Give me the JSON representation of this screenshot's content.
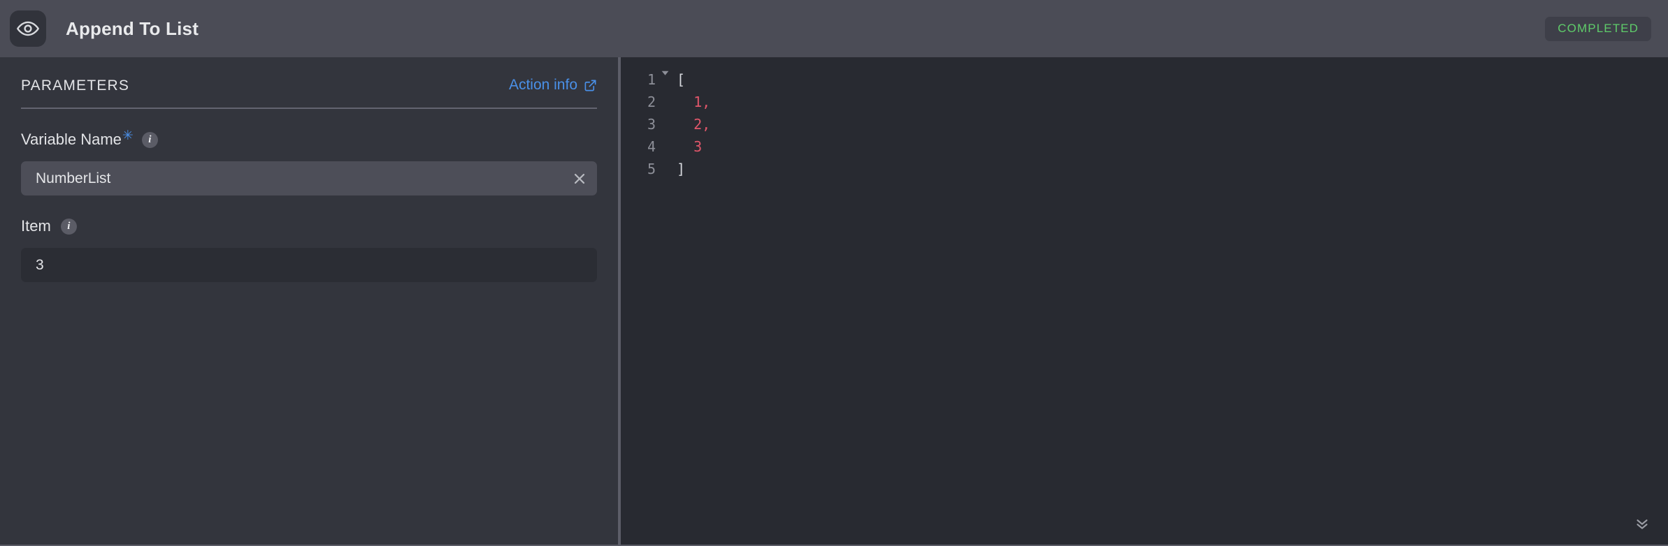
{
  "header": {
    "icon": "eye-icon",
    "title": "Append To List",
    "status": "COMPLETED",
    "status_color": "#5fcc6a",
    "background": "#4b4c56"
  },
  "left_panel": {
    "section_title": "PARAMETERS",
    "action_info": {
      "label": "Action info",
      "icon": "external-link-icon",
      "color": "#4a90e8"
    },
    "fields": [
      {
        "label": "Variable Name",
        "required": true,
        "required_marker": "✳",
        "info_icon": "info-icon",
        "value": "NumberList",
        "placeholder": "",
        "clearable": true,
        "clear_icon": "close-icon",
        "style": "filled"
      },
      {
        "label": "Item",
        "required": false,
        "required_marker": "",
        "info_icon": "info-icon",
        "value": "3",
        "placeholder": "",
        "clearable": false,
        "clear_icon": "",
        "style": "plain"
      }
    ]
  },
  "code_viewer": {
    "language": "json",
    "fold_icon": "chevron-down-triangle-icon",
    "collapse_all_icon": "double-chevron-down-icon",
    "lines": [
      {
        "number": "1",
        "foldable": true,
        "text": "[",
        "type": "punct"
      },
      {
        "number": "2",
        "foldable": false,
        "text": "  1,",
        "type": "number"
      },
      {
        "number": "3",
        "foldable": false,
        "text": "  2,",
        "type": "number"
      },
      {
        "number": "4",
        "foldable": false,
        "text": "  3",
        "type": "number"
      },
      {
        "number": "5",
        "foldable": false,
        "text": "]",
        "type": "punct"
      }
    ],
    "line_numbers": [
      "1",
      "2",
      "3",
      "4",
      "5"
    ],
    "raw": "[\n  1,\n  2,\n  3\n]",
    "number_color": "#e0566a",
    "punct_color": "#d6d8dd",
    "gutter_color": "#8d8f98"
  }
}
